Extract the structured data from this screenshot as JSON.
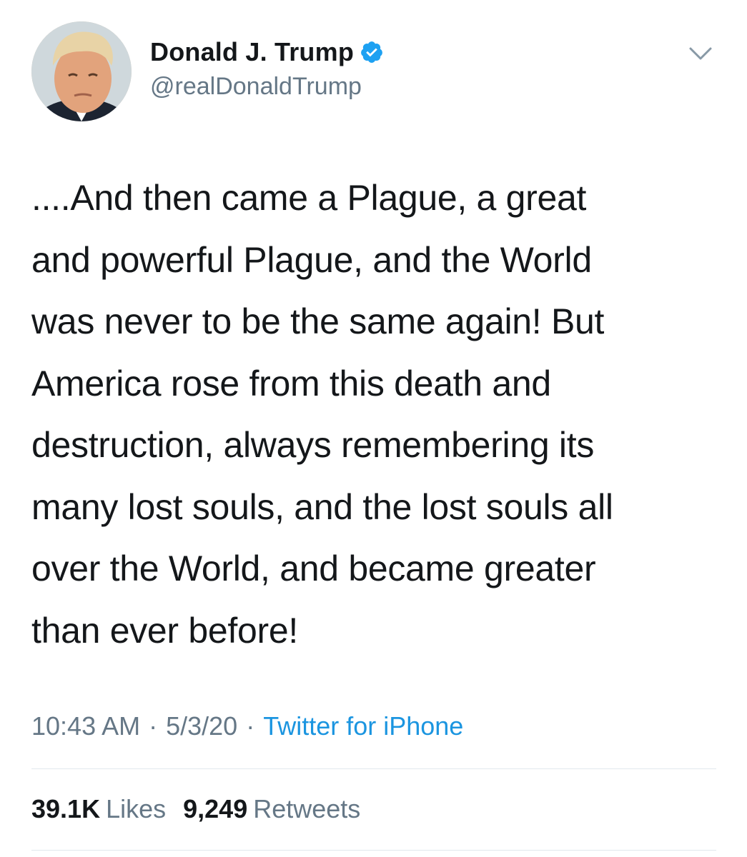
{
  "author": {
    "display_name": "Donald J. Trump",
    "handle": "@realDonaldTrump",
    "verified": true,
    "verified_color": "#1da1f2"
  },
  "tweet": {
    "text": "....And then came a Plague, a great\nand powerful Plague, and the World\nwas never to be the same again! But\nAmerica rose from this death and\ndestruction, always remembering its\nmany lost souls, and the lost souls all\nover the World, and became greater\nthan ever before!",
    "time": "10:43 AM",
    "date": "5/3/20",
    "separator": "·",
    "source": "Twitter for iPhone"
  },
  "stats": {
    "likes_count": "39.1K",
    "likes_label": "Likes",
    "retweets_count": "9,249",
    "retweets_label": "Retweets"
  },
  "icons": {
    "verified": "verified-badge-icon",
    "menu": "chevron-down-icon"
  },
  "colors": {
    "text": "#14171a",
    "secondary": "#657786",
    "link": "#1b95e0",
    "divider": "#e1e8ed"
  }
}
